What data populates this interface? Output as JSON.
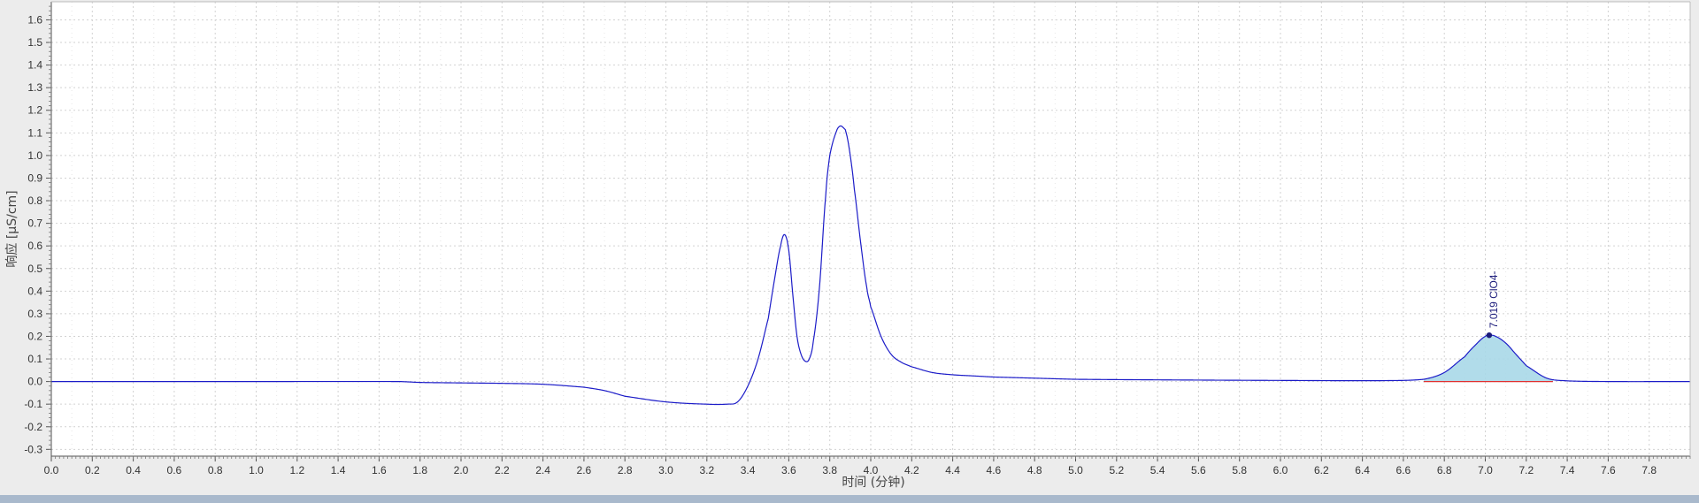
{
  "chart_data": {
    "type": "line",
    "xlabel": "时间 (分钟)",
    "ylabel": "响应 [µS/cm]",
    "xlim": [
      0.0,
      8.0
    ],
    "ylim": [
      -0.33,
      1.68
    ],
    "x_ticks": [
      0.0,
      0.2,
      0.4,
      0.6,
      0.8,
      1.0,
      1.2,
      1.4,
      1.6,
      1.8,
      2.0,
      2.2,
      2.4,
      2.6,
      2.8,
      3.0,
      3.2,
      3.4,
      3.6,
      3.8,
      4.0,
      4.2,
      4.4,
      4.6,
      4.8,
      5.0,
      5.2,
      5.4,
      5.6,
      5.8,
      6.0,
      6.2,
      6.4,
      6.6,
      6.8,
      7.0,
      7.2,
      7.4,
      7.6,
      7.8
    ],
    "x_tick_labels": [
      "0.0",
      "0.2",
      "0.4",
      "0.6",
      "0.8",
      "1.0",
      "1.2",
      "1.4",
      "1.6",
      "1.8",
      "2.0",
      "2.2",
      "2.4",
      "2.6",
      "2.8",
      "3.0",
      "3.2",
      "3.4",
      "3.6",
      "3.8",
      "4.0",
      "4.2",
      "4.4",
      "4.6",
      "4.8",
      "5.0",
      "5.2",
      "5.4",
      "5.6",
      "5.8",
      "6.0",
      "6.2",
      "6.4",
      "6.6",
      "6.8",
      "7.0",
      "7.2",
      "7.4",
      "7.6",
      "7.8"
    ],
    "y_ticks": [
      -0.3,
      -0.2,
      -0.1,
      0.0,
      0.1,
      0.2,
      0.3,
      0.4,
      0.5,
      0.6,
      0.7,
      0.8,
      0.9,
      1.0,
      1.1,
      1.2,
      1.3,
      1.4,
      1.5,
      1.6
    ],
    "y_tick_labels": [
      "-0.3",
      "-0.2",
      "-0.1",
      "0.0",
      "0.1",
      "0.2",
      "0.3",
      "0.4",
      "0.5",
      "0.6",
      "0.7",
      "0.8",
      "0.9",
      "1.0",
      "1.1",
      "1.2",
      "1.3",
      "1.4",
      "1.5",
      "1.6"
    ],
    "grid": true,
    "series": [
      {
        "color": "#1c1cc8",
        "x": [
          0.0,
          1.0,
          1.7,
          1.8,
          2.0,
          2.2,
          2.4,
          2.6,
          2.7,
          2.8,
          3.0,
          3.2,
          3.3,
          3.35,
          3.4,
          3.45,
          3.5,
          3.53,
          3.56,
          3.58,
          3.6,
          3.62,
          3.64,
          3.66,
          3.68,
          3.7,
          3.72,
          3.75,
          3.78,
          3.8,
          3.83,
          3.85,
          3.87,
          3.88,
          3.9,
          3.92,
          3.95,
          3.98,
          4.0,
          4.05,
          4.1,
          4.15,
          4.2,
          4.3,
          4.4,
          4.5,
          4.6,
          4.8,
          5.0,
          5.5,
          6.0,
          6.5,
          6.7,
          6.8,
          6.9,
          6.95,
          7.0,
          7.02,
          7.05,
          7.1,
          7.15,
          7.2,
          7.3,
          7.4,
          7.6,
          8.0
        ],
        "y": [
          0.0,
          0.0,
          0.0,
          -0.004,
          -0.006,
          -0.008,
          -0.012,
          -0.025,
          -0.04,
          -0.065,
          -0.09,
          -0.1,
          -0.1,
          -0.09,
          -0.02,
          0.1,
          0.28,
          0.45,
          0.6,
          0.65,
          0.58,
          0.38,
          0.2,
          0.12,
          0.09,
          0.1,
          0.18,
          0.42,
          0.82,
          1.0,
          1.1,
          1.13,
          1.12,
          1.1,
          1.0,
          0.85,
          0.62,
          0.42,
          0.33,
          0.2,
          0.12,
          0.085,
          0.065,
          0.04,
          0.03,
          0.025,
          0.02,
          0.015,
          0.01,
          0.007,
          0.005,
          0.004,
          0.01,
          0.04,
          0.11,
          0.16,
          0.2,
          0.205,
          0.2,
          0.17,
          0.12,
          0.07,
          0.015,
          0.003,
          0.0,
          0.0
        ]
      }
    ],
    "integrated_peak": {
      "x_start": 6.7,
      "x_end": 7.33,
      "fill_color": "#a8d8e8",
      "baseline_color": "#e03030"
    },
    "annotations": [
      {
        "x": 7.019,
        "y": 0.205,
        "text": "7.019 ClO4-"
      }
    ]
  }
}
